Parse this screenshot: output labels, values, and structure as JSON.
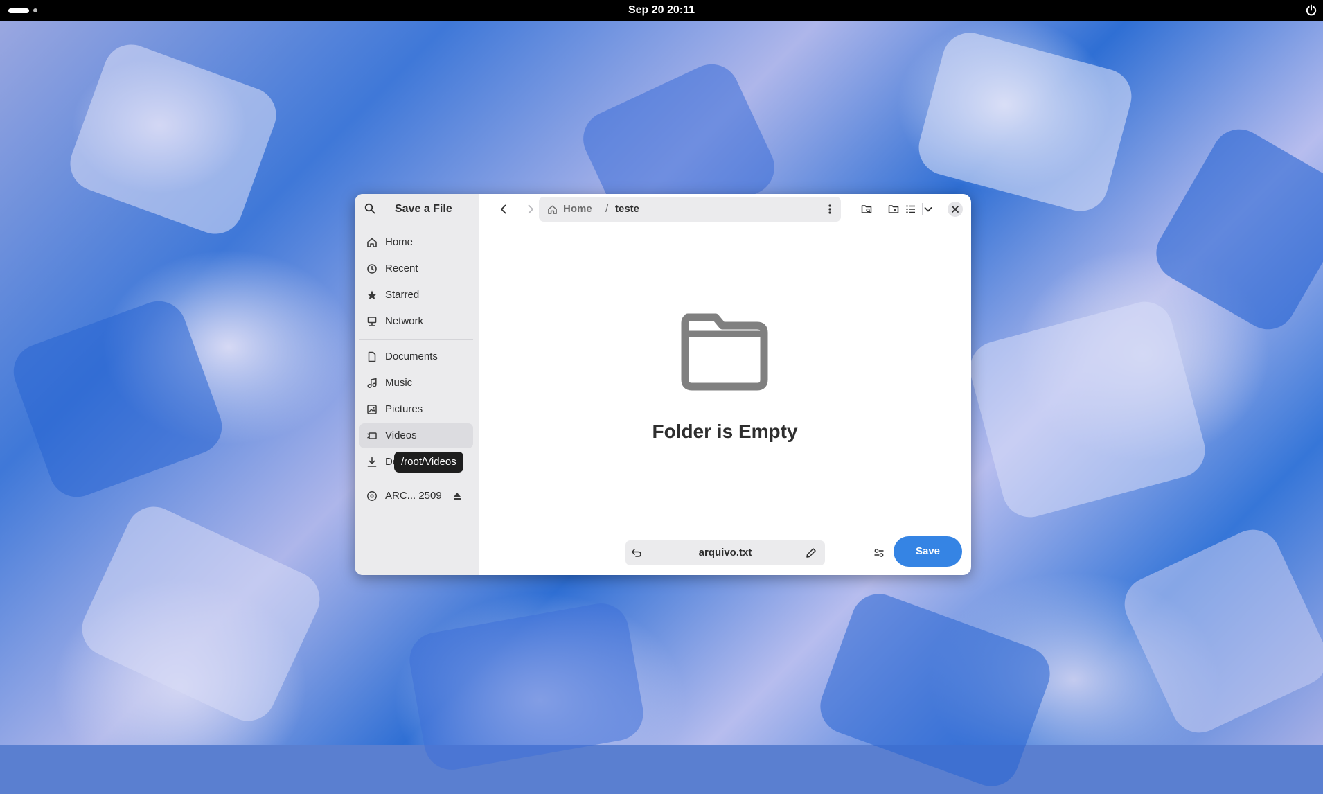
{
  "topbar": {
    "clock": "Sep 20  20:11",
    "icons": {
      "activities": "activities-indicator",
      "power": "power-icon"
    }
  },
  "dialog": {
    "title": "Save a File",
    "sidebar": {
      "places": [
        {
          "label": "Home",
          "icon": "home-icon"
        },
        {
          "label": "Recent",
          "icon": "clock-icon"
        },
        {
          "label": "Starred",
          "icon": "star-icon"
        },
        {
          "label": "Network",
          "icon": "network-icon"
        }
      ],
      "bookmarks": [
        {
          "label": "Documents",
          "icon": "document-icon"
        },
        {
          "label": "Music",
          "icon": "music-icon"
        },
        {
          "label": "Pictures",
          "icon": "picture-icon"
        },
        {
          "label": "Videos",
          "icon": "video-icon",
          "selected": true
        },
        {
          "label": "Downloads",
          "icon": "download-icon"
        }
      ],
      "devices": [
        {
          "label": "ARC... 2509",
          "icon": "disc-icon"
        }
      ],
      "tooltip": "/root/Videos"
    },
    "pathbar": {
      "home": "Home",
      "separator": "/",
      "current": "teste"
    },
    "empty_state": {
      "title": "Folder is Empty"
    },
    "filename": "arquivo.txt",
    "save_label": "Save",
    "colors": {
      "accent": "#3584e4",
      "sidebar_bg": "#ebebed",
      "topbar_bg": "#000000"
    }
  }
}
